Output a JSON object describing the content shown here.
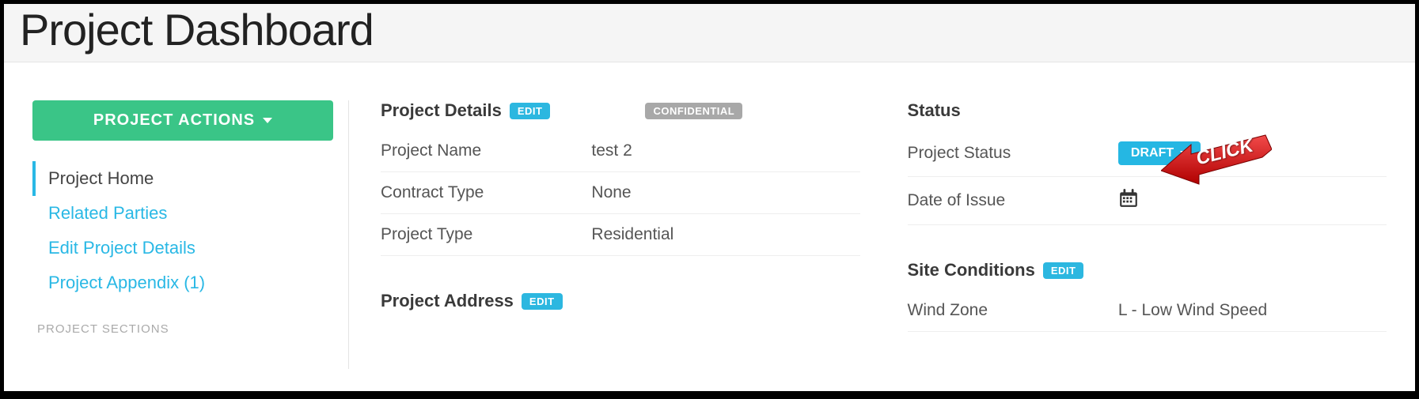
{
  "header": {
    "title": "Project Dashboard"
  },
  "sidebar": {
    "actions_label": "PROJECT ACTIONS",
    "items": [
      {
        "label": "Project Home",
        "active": true
      },
      {
        "label": "Related Parties",
        "active": false
      },
      {
        "label": "Edit Project Details",
        "active": false
      },
      {
        "label": "Project Appendix (1)",
        "active": false
      }
    ],
    "sub_header": "PROJECT SECTIONS"
  },
  "details": {
    "title": "Project Details",
    "edit_label": "EDIT",
    "conf_label": "CONFIDENTIAL",
    "rows": [
      {
        "key": "Project Name",
        "val": "test 2"
      },
      {
        "key": "Contract Type",
        "val": "None"
      },
      {
        "key": "Project Type",
        "val": "Residential"
      }
    ]
  },
  "address": {
    "title": "Project Address",
    "edit_label": "EDIT"
  },
  "status": {
    "title": "Status",
    "rows": [
      {
        "key": "Project Status"
      },
      {
        "key": "Date of Issue"
      }
    ],
    "draft_label": "DRAFT"
  },
  "site": {
    "title": "Site Conditions",
    "edit_label": "EDIT",
    "rows": [
      {
        "key": "Wind Zone",
        "val": "L - Low Wind Speed"
      }
    ]
  },
  "annotation": {
    "click_label": "CLICK"
  },
  "colors": {
    "green": "#3ac587",
    "blue": "#25b7e3",
    "gray": "#a8a8a8",
    "red": "#d81f1f"
  }
}
